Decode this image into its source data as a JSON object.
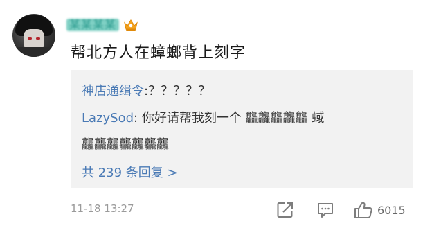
{
  "comment": {
    "username": "某某某某",
    "text": "帮北方人在蟑螂背上刻字",
    "timestamp": "11-18 13:27",
    "like_count": "6015"
  },
  "replies": [
    {
      "author": "神店通缉令",
      "text": ":？？？？？"
    },
    {
      "author": "LazySod",
      "text": ": 你好请帮我刻一个 龘龘龘龘龘 蜮"
    },
    {
      "author": "",
      "text": "龘龘龘龘龘龘龘"
    }
  ],
  "more_replies_label": "共 239 条回复 >",
  "icons": {
    "share": "share-icon",
    "comment": "comment-icon",
    "like": "thumbs-up-icon",
    "vip": "crown-badge-icon"
  },
  "colors": {
    "link_blue": "#4a7ab5",
    "reply_bg": "#f2f2f2",
    "meta_gray": "#9a9a9a",
    "badge_orange": "#f4a21c"
  }
}
